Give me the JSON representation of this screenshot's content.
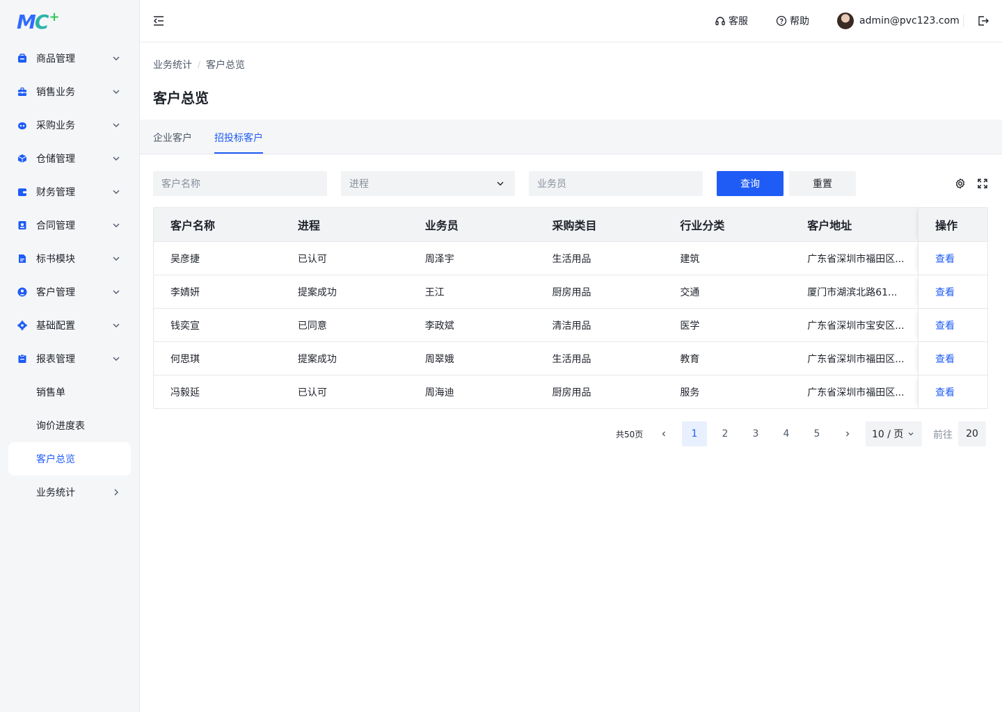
{
  "brand": {
    "logo_text_mc": "MC",
    "logo_plus": "+"
  },
  "sidebar": {
    "items": [
      {
        "label": "商品管理",
        "icon": "goods-icon"
      },
      {
        "label": "销售业务",
        "icon": "briefcase-icon"
      },
      {
        "label": "采购业务",
        "icon": "robot-icon"
      },
      {
        "label": "仓储管理",
        "icon": "box-icon"
      },
      {
        "label": "财务管理",
        "icon": "wallet-icon"
      },
      {
        "label": "合同管理",
        "icon": "contract-icon"
      },
      {
        "label": "标书模块",
        "icon": "document-icon"
      },
      {
        "label": "客户管理",
        "icon": "user-icon"
      },
      {
        "label": "基础配置",
        "icon": "gear-icon"
      },
      {
        "label": "报表管理",
        "icon": "clipboard-icon"
      }
    ],
    "sub_items": [
      {
        "label": "销售单"
      },
      {
        "label": "询价进度表"
      },
      {
        "label": "客户总览",
        "active": true
      },
      {
        "label": "业务统计"
      }
    ]
  },
  "topbar": {
    "service_label": "客服",
    "help_label": "帮助",
    "user_email": "admin@pvc123.com"
  },
  "breadcrumb": {
    "parent": "业务统计",
    "separator": "/",
    "current": "客户总览"
  },
  "page_title": "客户总览",
  "tabs": [
    {
      "label": "企业客户",
      "active": false
    },
    {
      "label": "招投标客户",
      "active": true
    }
  ],
  "filters": {
    "customer_name_placeholder": "客户名称",
    "progress_placeholder": "进程",
    "salesperson_placeholder": "业务员",
    "query_label": "查询",
    "reset_label": "重置"
  },
  "table": {
    "columns": [
      "客户名称",
      "进程",
      "业务员",
      "采购类目",
      "行业分类",
      "客户地址",
      "操作"
    ],
    "rows": [
      {
        "name": "吴彦捷",
        "progress": "已认可",
        "salesperson": "周泽宇",
        "category": "生活用品",
        "industry": "建筑",
        "address": "广东省深圳市福田区...",
        "action": "查看"
      },
      {
        "name": "李婧妍",
        "progress": "提案成功",
        "salesperson": "王江",
        "category": "厨房用品",
        "industry": "交通",
        "address": "厦门市湖滨北路61...",
        "action": "查看"
      },
      {
        "name": "钱奕宣",
        "progress": "已同意",
        "salesperson": "李政斌",
        "category": "清洁用品",
        "industry": "医学",
        "address": "广东省深圳市宝安区...",
        "action": "查看"
      },
      {
        "name": "何思琪",
        "progress": "提案成功",
        "salesperson": "周翠娥",
        "category": "生活用品",
        "industry": "教育",
        "address": "广东省深圳市福田区...",
        "action": "查看"
      },
      {
        "name": "冯毅延",
        "progress": "已认可",
        "salesperson": "周海迪",
        "category": "厨房用品",
        "industry": "服务",
        "address": "广东省深圳市福田区...",
        "action": "查看"
      }
    ]
  },
  "pagination": {
    "total_label": "共50页",
    "pages": [
      "1",
      "2",
      "3",
      "4",
      "5"
    ],
    "current_page": "1",
    "page_size_label": "10 / 页",
    "goto_label": "前往",
    "goto_value": "20"
  },
  "colors": {
    "primary": "#1f5cf5",
    "sidebar_bg": "#f5f6f8",
    "input_bg": "#f2f3f5"
  }
}
